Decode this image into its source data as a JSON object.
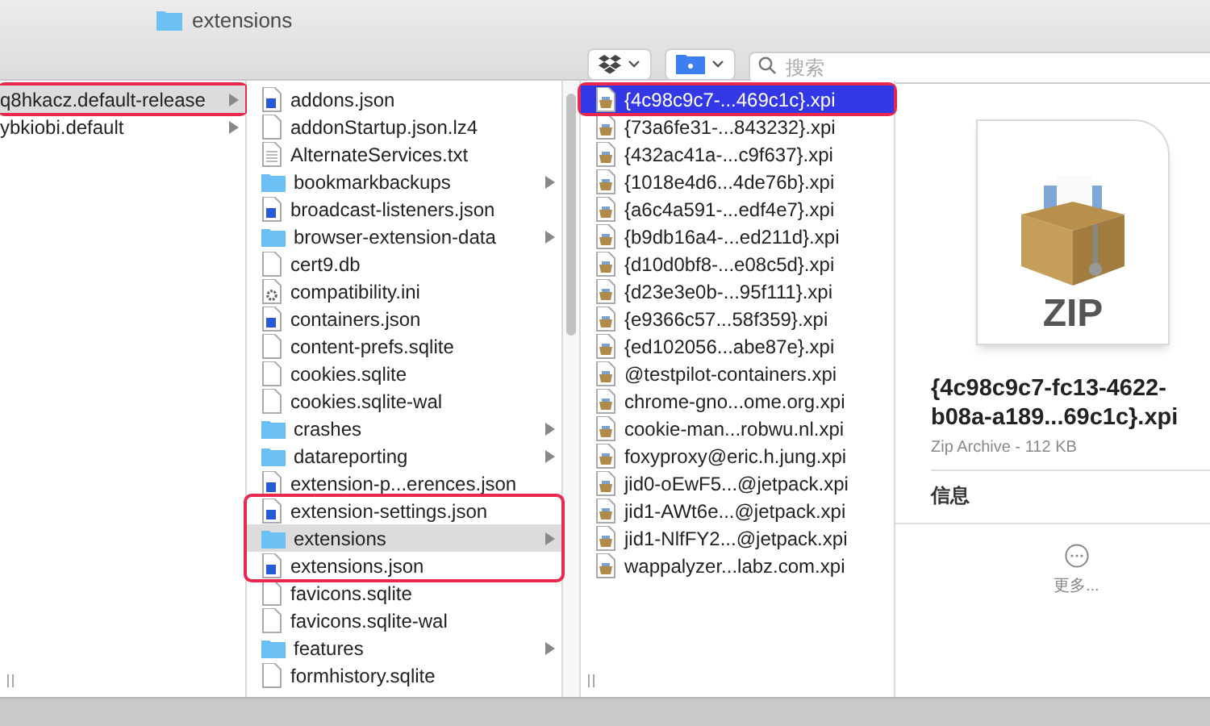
{
  "window": {
    "title": "extensions"
  },
  "toolbar": {
    "search": {
      "placeholder": "搜索"
    }
  },
  "columns": [
    {
      "focused": false,
      "items": [
        {
          "name": "q8hkacz.default-release",
          "expandable": true,
          "selected": true,
          "circled": true
        },
        {
          "name": "ybkiobi.default",
          "expandable": true,
          "selected": false,
          "circled": false
        }
      ]
    },
    {
      "focused": false,
      "items": [
        {
          "name": "addons.json",
          "kind": "json",
          "expandable": false,
          "selected": false,
          "circled": false
        },
        {
          "name": "addonStartup.json.lz4",
          "kind": "blank",
          "expandable": false,
          "selected": false,
          "circled": false
        },
        {
          "name": "AlternateServices.txt",
          "kind": "text",
          "expandable": false,
          "selected": false,
          "circled": false
        },
        {
          "name": "bookmarkbackups",
          "kind": "folder",
          "expandable": true,
          "selected": false,
          "circled": false
        },
        {
          "name": "broadcast-listeners.json",
          "kind": "json",
          "expandable": false,
          "selected": false,
          "circled": false
        },
        {
          "name": "browser-extension-data",
          "kind": "folder",
          "expandable": true,
          "selected": false,
          "circled": false
        },
        {
          "name": "cert9.db",
          "kind": "blank",
          "expandable": false,
          "selected": false,
          "circled": false
        },
        {
          "name": "compatibility.ini",
          "kind": "settings",
          "expandable": false,
          "selected": false,
          "circled": false
        },
        {
          "name": "containers.json",
          "kind": "json",
          "expandable": false,
          "selected": false,
          "circled": false
        },
        {
          "name": "content-prefs.sqlite",
          "kind": "blank",
          "expandable": false,
          "selected": false,
          "circled": false
        },
        {
          "name": "cookies.sqlite",
          "kind": "blank",
          "expandable": false,
          "selected": false,
          "circled": false
        },
        {
          "name": "cookies.sqlite-wal",
          "kind": "blank",
          "expandable": false,
          "selected": false,
          "circled": false
        },
        {
          "name": "crashes",
          "kind": "folder",
          "expandable": true,
          "selected": false,
          "circled": false
        },
        {
          "name": "datareporting",
          "kind": "folder",
          "expandable": true,
          "selected": false,
          "circled": false
        },
        {
          "name": "extension-p...erences.json",
          "kind": "json",
          "expandable": false,
          "selected": false,
          "circled": false
        },
        {
          "name": "extension-settings.json",
          "kind": "json",
          "expandable": false,
          "selected": false,
          "circled": true
        },
        {
          "name": "extensions",
          "kind": "folder",
          "expandable": true,
          "selected": true,
          "circled": true
        },
        {
          "name": "extensions.json",
          "kind": "json",
          "expandable": false,
          "selected": false,
          "circled": true
        },
        {
          "name": "favicons.sqlite",
          "kind": "blank",
          "expandable": false,
          "selected": false,
          "circled": false
        },
        {
          "name": "favicons.sqlite-wal",
          "kind": "blank",
          "expandable": false,
          "selected": false,
          "circled": false
        },
        {
          "name": "features",
          "kind": "folder",
          "expandable": true,
          "selected": false,
          "circled": false
        },
        {
          "name": "formhistory.sqlite",
          "kind": "blank",
          "expandable": false,
          "selected": false,
          "circled": false
        }
      ]
    },
    {
      "focused": true,
      "items": [
        {
          "name": "{4c98c9c7-...469c1c}.xpi",
          "kind": "package",
          "expandable": false,
          "selected": true,
          "circled": true
        },
        {
          "name": "{73a6fe31-...843232}.xpi",
          "kind": "package",
          "expandable": false,
          "selected": false,
          "circled": false
        },
        {
          "name": "{432ac41a-...c9f637}.xpi",
          "kind": "package",
          "expandable": false,
          "selected": false,
          "circled": false
        },
        {
          "name": "{1018e4d6...4de76b}.xpi",
          "kind": "package",
          "expandable": false,
          "selected": false,
          "circled": false
        },
        {
          "name": "{a6c4a591-...edf4e7}.xpi",
          "kind": "package",
          "expandable": false,
          "selected": false,
          "circled": false
        },
        {
          "name": "{b9db16a4-...ed211d}.xpi",
          "kind": "package",
          "expandable": false,
          "selected": false,
          "circled": false
        },
        {
          "name": "{d10d0bf8-...e08c5d}.xpi",
          "kind": "package",
          "expandable": false,
          "selected": false,
          "circled": false
        },
        {
          "name": "{d23e3e0b-...95f111}.xpi",
          "kind": "package",
          "expandable": false,
          "selected": false,
          "circled": false
        },
        {
          "name": "{e9366c57...58f359}.xpi",
          "kind": "package",
          "expandable": false,
          "selected": false,
          "circled": false
        },
        {
          "name": "{ed102056...abe87e}.xpi",
          "kind": "package",
          "expandable": false,
          "selected": false,
          "circled": false
        },
        {
          "name": "@testpilot-containers.xpi",
          "kind": "package",
          "expandable": false,
          "selected": false,
          "circled": false
        },
        {
          "name": "chrome-gno...ome.org.xpi",
          "kind": "package",
          "expandable": false,
          "selected": false,
          "circled": false
        },
        {
          "name": "cookie-man...robwu.nl.xpi",
          "kind": "package",
          "expandable": false,
          "selected": false,
          "circled": false
        },
        {
          "name": "foxyproxy@eric.h.jung.xpi",
          "kind": "package",
          "expandable": false,
          "selected": false,
          "circled": false
        },
        {
          "name": "jid0-oEwF5...@jetpack.xpi",
          "kind": "package",
          "expandable": false,
          "selected": false,
          "circled": false
        },
        {
          "name": "jid1-AWt6e...@jetpack.xpi",
          "kind": "package",
          "expandable": false,
          "selected": false,
          "circled": false
        },
        {
          "name": "jid1-NlfFY2...@jetpack.xpi",
          "kind": "package",
          "expandable": false,
          "selected": false,
          "circled": false
        },
        {
          "name": "wappalyzer...labz.com.xpi",
          "kind": "package",
          "expandable": false,
          "selected": false,
          "circled": false
        }
      ]
    }
  ],
  "preview": {
    "badge": "ZIP",
    "name": "{4c98c9c7-fc13-4622-b08a-a189...69c1c}.xpi",
    "info": "Zip Archive - 112 KB",
    "section": "信息",
    "more": "更多..."
  }
}
